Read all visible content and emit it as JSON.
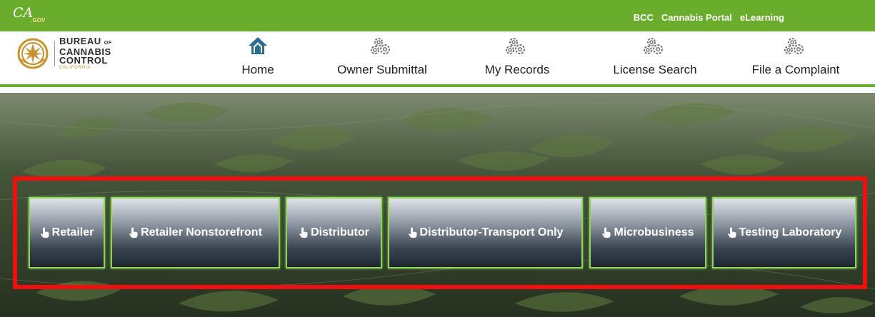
{
  "header": {
    "logo_text": "CA",
    "logo_sub": ".GOV",
    "top_links": [
      "BCC",
      "Cannabis Portal",
      "eLearning"
    ]
  },
  "brand": {
    "line1": "BUREAU",
    "line1_of": "OF",
    "line2": "CANNABIS",
    "line3": "CONTROL",
    "line4": "CALIFORNIA"
  },
  "nav": {
    "items": [
      {
        "label": "Home",
        "icon": "home-icon"
      },
      {
        "label": "Owner Submittal",
        "icon": "gears-icon"
      },
      {
        "label": "My Records",
        "icon": "gears-icon"
      },
      {
        "label": "License Search",
        "icon": "gears-icon"
      },
      {
        "label": "File a Complaint",
        "icon": "gears-icon"
      }
    ]
  },
  "license_types": {
    "icon": "hand-pointer-icon",
    "buttons": [
      {
        "label": "Retailer"
      },
      {
        "label": "Retailer Nonstorefront"
      },
      {
        "label": "Distributor"
      },
      {
        "label": "Distributor-Transport Only"
      },
      {
        "label": "Microbusiness"
      },
      {
        "label": "Testing Laboratory"
      }
    ]
  },
  "colors": {
    "brand_green": "#6aac2b",
    "highlight_red": "#ee0f0f",
    "button_border": "#8cd55a"
  }
}
